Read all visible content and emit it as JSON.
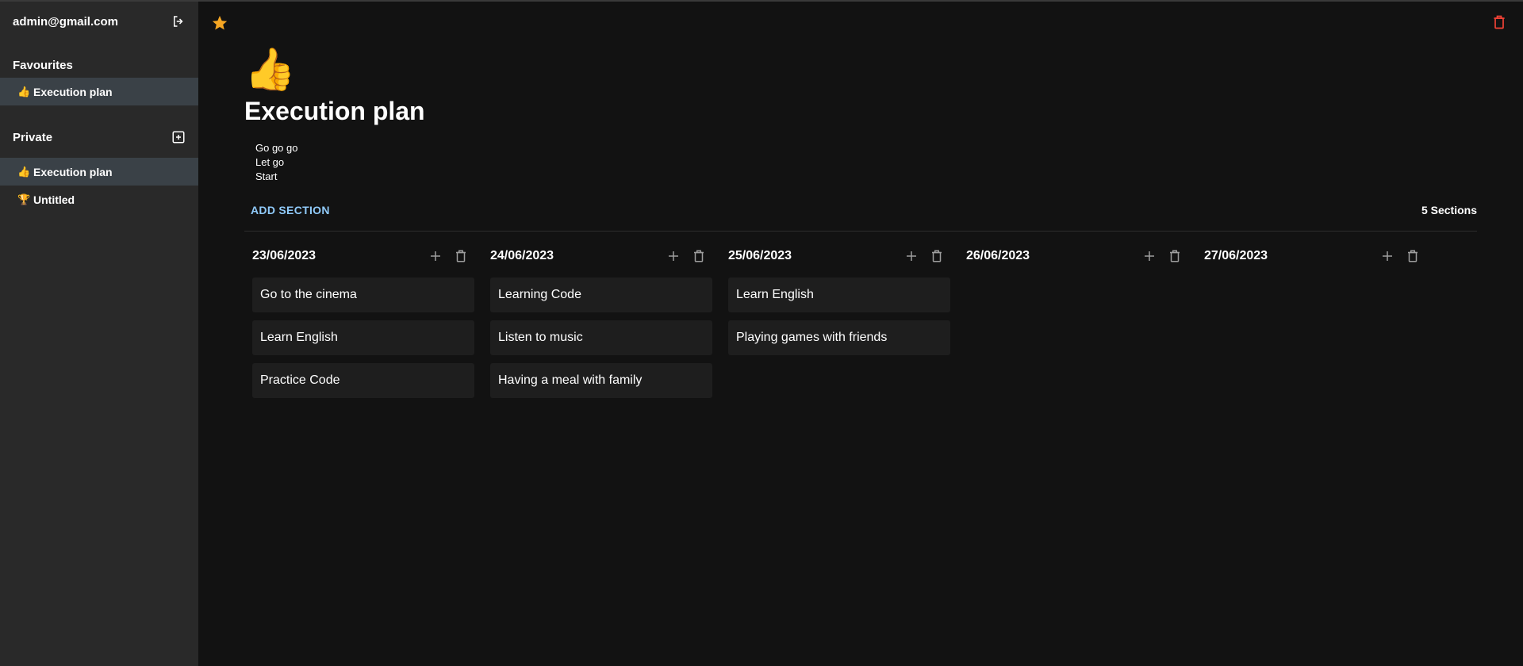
{
  "sidebar": {
    "user_email": "admin@gmail.com",
    "favourites_label": "Favourites",
    "favourites": [
      {
        "emoji": "👍",
        "label": "Execution plan"
      }
    ],
    "private_label": "Private",
    "private": [
      {
        "emoji": "👍",
        "label": "Execution plan"
      },
      {
        "emoji": "🏆",
        "label": "Untitled"
      }
    ]
  },
  "page": {
    "icon": "👍",
    "title": "Execution plan",
    "description": [
      "Go go go",
      "Let go",
      "Start"
    ],
    "add_section_label": "ADD SECTION",
    "sections_count_label": "5 Sections"
  },
  "sections": [
    {
      "title": "23/06/2023",
      "tasks": [
        "Go to the cinema",
        "Learn English",
        "Practice Code"
      ]
    },
    {
      "title": "24/06/2023",
      "tasks": [
        "Learning Code",
        "Listen to music",
        "Having a meal with family"
      ]
    },
    {
      "title": "25/06/2023",
      "tasks": [
        "Learn English",
        "Playing games with friends"
      ]
    },
    {
      "title": "26/06/2023",
      "tasks": []
    },
    {
      "title": "27/06/2023",
      "tasks": []
    }
  ],
  "colors": {
    "star": "#f5a623",
    "delete": "#f44336",
    "accent": "#90caf9",
    "sidebar_bg": "#292929",
    "main_bg": "#121212"
  },
  "icons": {
    "logout": "logout-icon",
    "add_page": "add-box-icon",
    "star": "star-icon",
    "delete": "trash-icon",
    "add_task": "plus-icon"
  }
}
